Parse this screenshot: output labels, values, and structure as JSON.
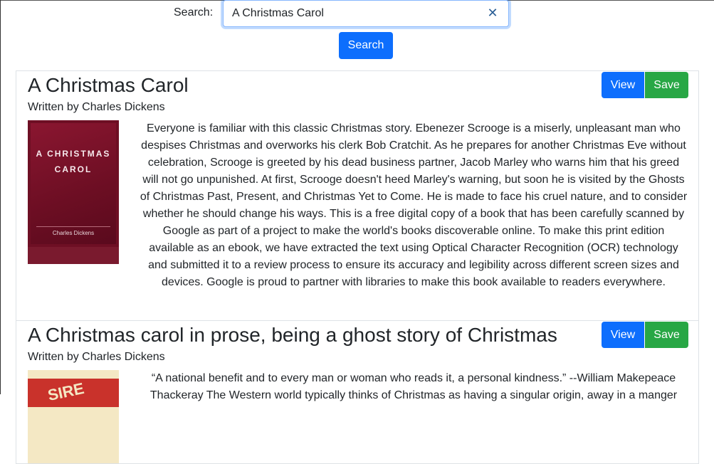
{
  "search": {
    "label": "Search:",
    "value": "A Christmas Carol",
    "button_label": "Search"
  },
  "results": [
    {
      "title": "A Christmas Carol",
      "author": "Written by Charles Dickens",
      "view_label": "View",
      "save_label": "Save",
      "cover_title_line1": "A CHRISTMAS",
      "cover_title_line2": "CAROL",
      "cover_author": "Charles Dickens",
      "description": "Everyone is familiar with this classic Christmas story. Ebenezer Scrooge is a miserly, unpleasant man who despises Christmas and overworks his clerk Bob Cratchit. As he prepares for another Christmas Eve without celebration, Scrooge is greeted by his dead business partner, Jacob Marley who warns him that his greed will not go unpunished. At first, Scrooge doesn't heed Marley's warning, but soon he is visited by the Ghosts of Christmas Past, Present, and Christmas Yet to Come. He is made to face his cruel nature, and to consider whether he should change his ways. This is a free digital copy of a book that has been carefully scanned by Google as part of a project to make the world's books discoverable online. To make this print edition available as an ebook, we have extracted the text using Optical Character Recognition (OCR) technology and submitted it to a review process to ensure its accuracy and legibility across different screen sizes and devices. Google is proud to partner with libraries to make this book available to readers everywhere."
    },
    {
      "title": "A Christmas carol in prose, being a ghost story of Christmas",
      "author": "Written by Charles Dickens",
      "view_label": "View",
      "save_label": "Save",
      "description": "“A national benefit and to every man or woman who reads it, a personal kindness.” --William Makepeace Thackeray The Western world typically thinks of Christmas as having a singular origin, away in a manger"
    }
  ]
}
